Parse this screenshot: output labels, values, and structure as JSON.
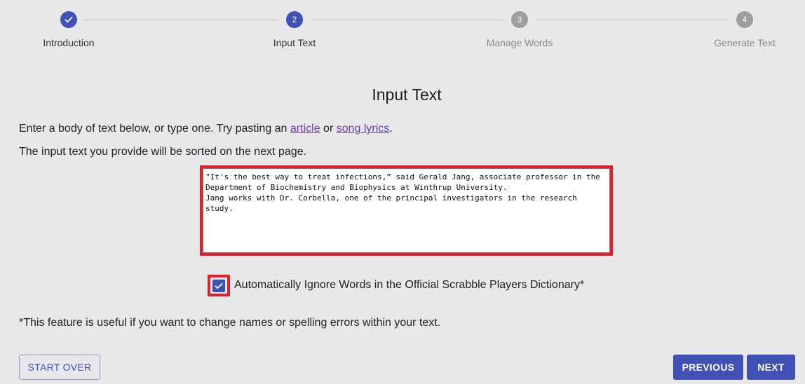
{
  "stepper": {
    "steps": [
      {
        "number": "1",
        "label": "Introduction",
        "state": "completed"
      },
      {
        "number": "2",
        "label": "Input Text",
        "state": "active"
      },
      {
        "number": "3",
        "label": "Manage Words",
        "state": "upcoming"
      },
      {
        "number": "4",
        "label": "Generate Text",
        "state": "upcoming"
      }
    ],
    "completed_icon": "check-icon"
  },
  "main": {
    "title": "Input Text",
    "intro_prefix": "Enter a body of text below, or type one. Try pasting an ",
    "article_link": "article",
    "intro_or": " or ",
    "lyrics_link": "song lyrics",
    "intro_suffix": ".",
    "sort_note": "The input text you provide will be sorted on the next page.",
    "input_text": "\"It's the best way to treat infections,” said Gerald Jang, associate professor in the Department of Biochemistry and Biophysics at Winthrup University.\nJang works with Dr. Corbella, one of the principal investigators in the research study.",
    "checkbox_label": "Automatically Ignore Words in the Official Scrabble Players Dictionary*",
    "checkbox_checked": true,
    "footnote": "*This feature is useful if you want to change names or spelling errors within your text."
  },
  "buttons": {
    "start_over": "START OVER",
    "previous": "PREVIOUS",
    "next": "NEXT"
  },
  "colors": {
    "primary": "#3f51b5",
    "highlight": "#e3202a",
    "inactive": "#9e9e9e",
    "link": "#6a3fa0"
  }
}
